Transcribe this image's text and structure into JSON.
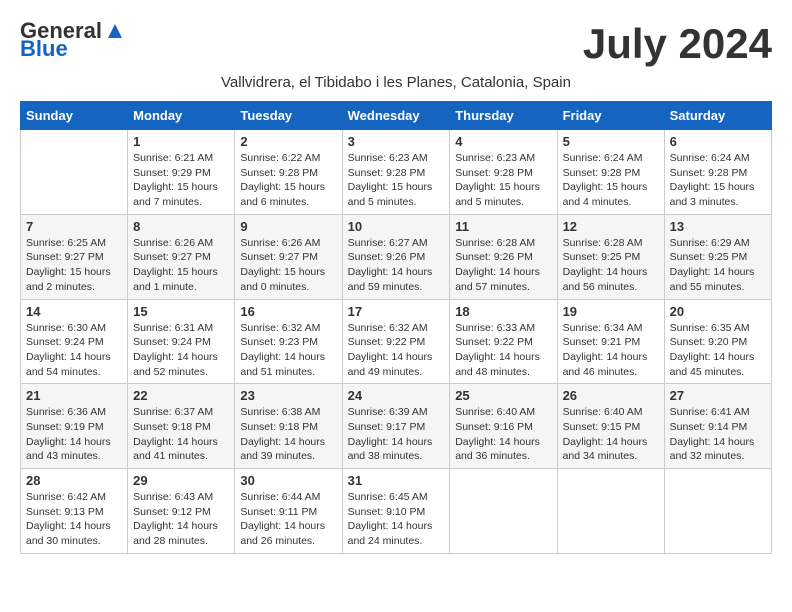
{
  "logo": {
    "general": "General",
    "blue": "Blue"
  },
  "title": "July 2024",
  "subtitle": "Vallvidrera, el Tibidabo i les Planes, Catalonia, Spain",
  "headers": [
    "Sunday",
    "Monday",
    "Tuesday",
    "Wednesday",
    "Thursday",
    "Friday",
    "Saturday"
  ],
  "weeks": [
    [
      {
        "day": "",
        "sunrise": "",
        "sunset": "",
        "daylight": ""
      },
      {
        "day": "1",
        "sunrise": "Sunrise: 6:21 AM",
        "sunset": "Sunset: 9:29 PM",
        "daylight": "Daylight: 15 hours and 7 minutes."
      },
      {
        "day": "2",
        "sunrise": "Sunrise: 6:22 AM",
        "sunset": "Sunset: 9:28 PM",
        "daylight": "Daylight: 15 hours and 6 minutes."
      },
      {
        "day": "3",
        "sunrise": "Sunrise: 6:23 AM",
        "sunset": "Sunset: 9:28 PM",
        "daylight": "Daylight: 15 hours and 5 minutes."
      },
      {
        "day": "4",
        "sunrise": "Sunrise: 6:23 AM",
        "sunset": "Sunset: 9:28 PM",
        "daylight": "Daylight: 15 hours and 5 minutes."
      },
      {
        "day": "5",
        "sunrise": "Sunrise: 6:24 AM",
        "sunset": "Sunset: 9:28 PM",
        "daylight": "Daylight: 15 hours and 4 minutes."
      },
      {
        "day": "6",
        "sunrise": "Sunrise: 6:24 AM",
        "sunset": "Sunset: 9:28 PM",
        "daylight": "Daylight: 15 hours and 3 minutes."
      }
    ],
    [
      {
        "day": "7",
        "sunrise": "Sunrise: 6:25 AM",
        "sunset": "Sunset: 9:27 PM",
        "daylight": "Daylight: 15 hours and 2 minutes."
      },
      {
        "day": "8",
        "sunrise": "Sunrise: 6:26 AM",
        "sunset": "Sunset: 9:27 PM",
        "daylight": "Daylight: 15 hours and 1 minute."
      },
      {
        "day": "9",
        "sunrise": "Sunrise: 6:26 AM",
        "sunset": "Sunset: 9:27 PM",
        "daylight": "Daylight: 15 hours and 0 minutes."
      },
      {
        "day": "10",
        "sunrise": "Sunrise: 6:27 AM",
        "sunset": "Sunset: 9:26 PM",
        "daylight": "Daylight: 14 hours and 59 minutes."
      },
      {
        "day": "11",
        "sunrise": "Sunrise: 6:28 AM",
        "sunset": "Sunset: 9:26 PM",
        "daylight": "Daylight: 14 hours and 57 minutes."
      },
      {
        "day": "12",
        "sunrise": "Sunrise: 6:28 AM",
        "sunset": "Sunset: 9:25 PM",
        "daylight": "Daylight: 14 hours and 56 minutes."
      },
      {
        "day": "13",
        "sunrise": "Sunrise: 6:29 AM",
        "sunset": "Sunset: 9:25 PM",
        "daylight": "Daylight: 14 hours and 55 minutes."
      }
    ],
    [
      {
        "day": "14",
        "sunrise": "Sunrise: 6:30 AM",
        "sunset": "Sunset: 9:24 PM",
        "daylight": "Daylight: 14 hours and 54 minutes."
      },
      {
        "day": "15",
        "sunrise": "Sunrise: 6:31 AM",
        "sunset": "Sunset: 9:24 PM",
        "daylight": "Daylight: 14 hours and 52 minutes."
      },
      {
        "day": "16",
        "sunrise": "Sunrise: 6:32 AM",
        "sunset": "Sunset: 9:23 PM",
        "daylight": "Daylight: 14 hours and 51 minutes."
      },
      {
        "day": "17",
        "sunrise": "Sunrise: 6:32 AM",
        "sunset": "Sunset: 9:22 PM",
        "daylight": "Daylight: 14 hours and 49 minutes."
      },
      {
        "day": "18",
        "sunrise": "Sunrise: 6:33 AM",
        "sunset": "Sunset: 9:22 PM",
        "daylight": "Daylight: 14 hours and 48 minutes."
      },
      {
        "day": "19",
        "sunrise": "Sunrise: 6:34 AM",
        "sunset": "Sunset: 9:21 PM",
        "daylight": "Daylight: 14 hours and 46 minutes."
      },
      {
        "day": "20",
        "sunrise": "Sunrise: 6:35 AM",
        "sunset": "Sunset: 9:20 PM",
        "daylight": "Daylight: 14 hours and 45 minutes."
      }
    ],
    [
      {
        "day": "21",
        "sunrise": "Sunrise: 6:36 AM",
        "sunset": "Sunset: 9:19 PM",
        "daylight": "Daylight: 14 hours and 43 minutes."
      },
      {
        "day": "22",
        "sunrise": "Sunrise: 6:37 AM",
        "sunset": "Sunset: 9:18 PM",
        "daylight": "Daylight: 14 hours and 41 minutes."
      },
      {
        "day": "23",
        "sunrise": "Sunrise: 6:38 AM",
        "sunset": "Sunset: 9:18 PM",
        "daylight": "Daylight: 14 hours and 39 minutes."
      },
      {
        "day": "24",
        "sunrise": "Sunrise: 6:39 AM",
        "sunset": "Sunset: 9:17 PM",
        "daylight": "Daylight: 14 hours and 38 minutes."
      },
      {
        "day": "25",
        "sunrise": "Sunrise: 6:40 AM",
        "sunset": "Sunset: 9:16 PM",
        "daylight": "Daylight: 14 hours and 36 minutes."
      },
      {
        "day": "26",
        "sunrise": "Sunrise: 6:40 AM",
        "sunset": "Sunset: 9:15 PM",
        "daylight": "Daylight: 14 hours and 34 minutes."
      },
      {
        "day": "27",
        "sunrise": "Sunrise: 6:41 AM",
        "sunset": "Sunset: 9:14 PM",
        "daylight": "Daylight: 14 hours and 32 minutes."
      }
    ],
    [
      {
        "day": "28",
        "sunrise": "Sunrise: 6:42 AM",
        "sunset": "Sunset: 9:13 PM",
        "daylight": "Daylight: 14 hours and 30 minutes."
      },
      {
        "day": "29",
        "sunrise": "Sunrise: 6:43 AM",
        "sunset": "Sunset: 9:12 PM",
        "daylight": "Daylight: 14 hours and 28 minutes."
      },
      {
        "day": "30",
        "sunrise": "Sunrise: 6:44 AM",
        "sunset": "Sunset: 9:11 PM",
        "daylight": "Daylight: 14 hours and 26 minutes."
      },
      {
        "day": "31",
        "sunrise": "Sunrise: 6:45 AM",
        "sunset": "Sunset: 9:10 PM",
        "daylight": "Daylight: 14 hours and 24 minutes."
      },
      {
        "day": "",
        "sunrise": "",
        "sunset": "",
        "daylight": ""
      },
      {
        "day": "",
        "sunrise": "",
        "sunset": "",
        "daylight": ""
      },
      {
        "day": "",
        "sunrise": "",
        "sunset": "",
        "daylight": ""
      }
    ]
  ]
}
